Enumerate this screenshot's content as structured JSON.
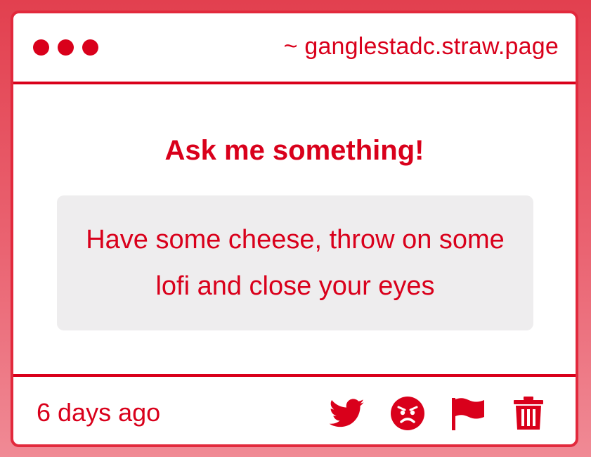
{
  "window": {
    "url": "~ ganglestadc.straw.page"
  },
  "main": {
    "heading": "Ask me something!",
    "answer": "Have some cheese, throw on some lofi and close your eyes"
  },
  "footer": {
    "timestamp": "6 days ago",
    "actions": [
      "twitter-icon",
      "angry-face-icon",
      "flag-icon",
      "trash-icon"
    ]
  },
  "colors": {
    "accent": "#d9001b",
    "answer_bg": "#eeedee",
    "background": "#e2404f"
  }
}
